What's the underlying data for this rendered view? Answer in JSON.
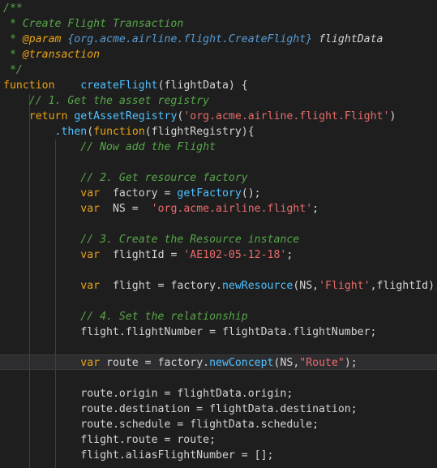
{
  "colors": {
    "background": "#1e1e1e",
    "comment": "#57a64a",
    "keyword": "#e8a317",
    "function": "#dcdcaa",
    "string": "#e96b6b",
    "text": "#d4d4d4",
    "highlight_line": "#2d2d30"
  },
  "code": {
    "l1": "/**",
    "l2": " * Create Flight Transaction",
    "l3_a": " * ",
    "l3_tag": "@param",
    "l3_b": " {org.acme.airline.flight.CreateFlight} ",
    "l3_param": "flightData",
    "l4_a": " * ",
    "l4_tag": "@transaction",
    "l5": " */",
    "l6_kw": "function",
    "l6_sp": "    ",
    "l6_fn": "createFlight",
    "l6_rest": "(flightData) {",
    "l7": "    // 1. Get the asset registry",
    "l8_indent": "    ",
    "l8_kw": "return",
    "l8_sp": " ",
    "l8_fn": "getAssetRegistry",
    "l8_p1": "(",
    "l8_str": "'org.acme.airline.flight.Flight'",
    "l8_p2": ")",
    "l9_indent": "        ",
    "l9_then": ".then",
    "l9_p1": "(",
    "l9_kw": "function",
    "l9_rest": "(flightRegistry){",
    "l10": "            // Now add the Flight",
    "l12": "            // 2. Get resource factory",
    "l13_indent": "            ",
    "l13_kw": "var",
    "l13_a": "  factory = ",
    "l13_fn": "getFactory",
    "l13_b": "();",
    "l14_indent": "            ",
    "l14_kw": "var",
    "l14_a": "  NS =  ",
    "l14_str": "'org.acme.airline.flight'",
    "l14_b": ";",
    "l16": "            // 3. Create the Resource instance",
    "l17_indent": "            ",
    "l17_kw": "var",
    "l17_a": "  flightId = ",
    "l17_str": "'AE102-05-12-18'",
    "l17_b": ";",
    "l19_indent": "            ",
    "l19_kw": "var",
    "l19_a": "  flight = factory.",
    "l19_fn": "newResource",
    "l19_b": "(NS,",
    "l19_str": "'Flight'",
    "l19_c": ",flightId);",
    "l21": "            // 4. Set the relationship",
    "l22": "            flight.flightNumber = flightData.flightNumber;",
    "l24_indent": "            ",
    "l24_kw": "var",
    "l24_a": " route = factory.",
    "l24_fn": "newConcept",
    "l24_b": "(NS,",
    "l24_str": "\"Route\"",
    "l24_c": ");",
    "l26": "            route.origin = flightData.origin;",
    "l27": "            route.destination = flightData.destination;",
    "l28": "            route.schedule = flightData.schedule;",
    "l29": "            flight.route = route;",
    "l30": "            flight.aliasFlightNumber = [];"
  }
}
